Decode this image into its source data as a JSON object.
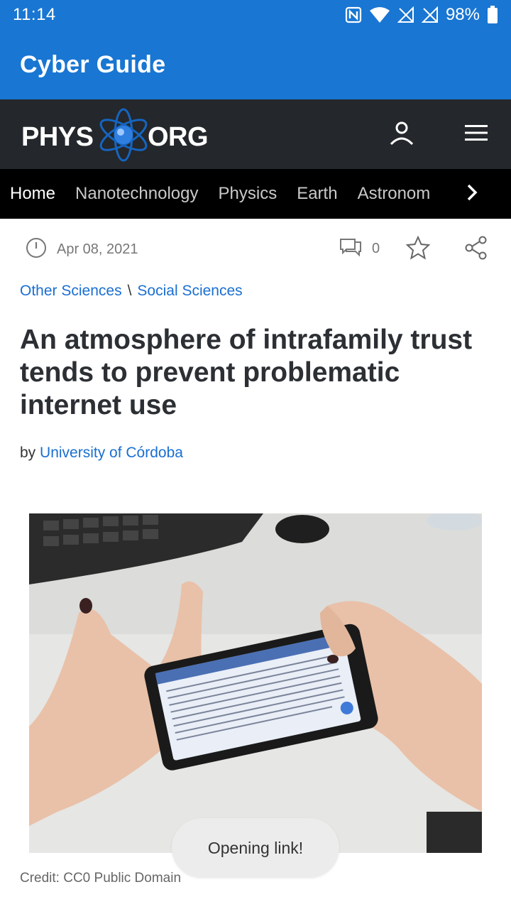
{
  "status_bar": {
    "time": "11:14",
    "battery": "98%"
  },
  "app": {
    "title": "Cyber Guide"
  },
  "site": {
    "logo_left": "PHYS",
    "logo_right": "ORG"
  },
  "categories": [
    {
      "label": "Home"
    },
    {
      "label": "Nanotechnology"
    },
    {
      "label": "Physics"
    },
    {
      "label": "Earth"
    },
    {
      "label": "Astronom"
    }
  ],
  "meta": {
    "date": "Apr 08, 2021",
    "comment_count": "0"
  },
  "breadcrumb": {
    "first": "Other Sciences",
    "separator": "\\",
    "second": "Social Sciences"
  },
  "article": {
    "title": "An atmosphere of intrafamily trust tends to prevent problematic internet use",
    "byline_prefix": "by",
    "author": "University of Córdoba",
    "caption": "Credit: CC0 Public Domain"
  },
  "toast": {
    "text": "Opening link!"
  },
  "colors": {
    "app_bar": "#1976d2",
    "site_header": "#24272b",
    "nav_bg": "#000000",
    "link": "#1a6fd1"
  }
}
